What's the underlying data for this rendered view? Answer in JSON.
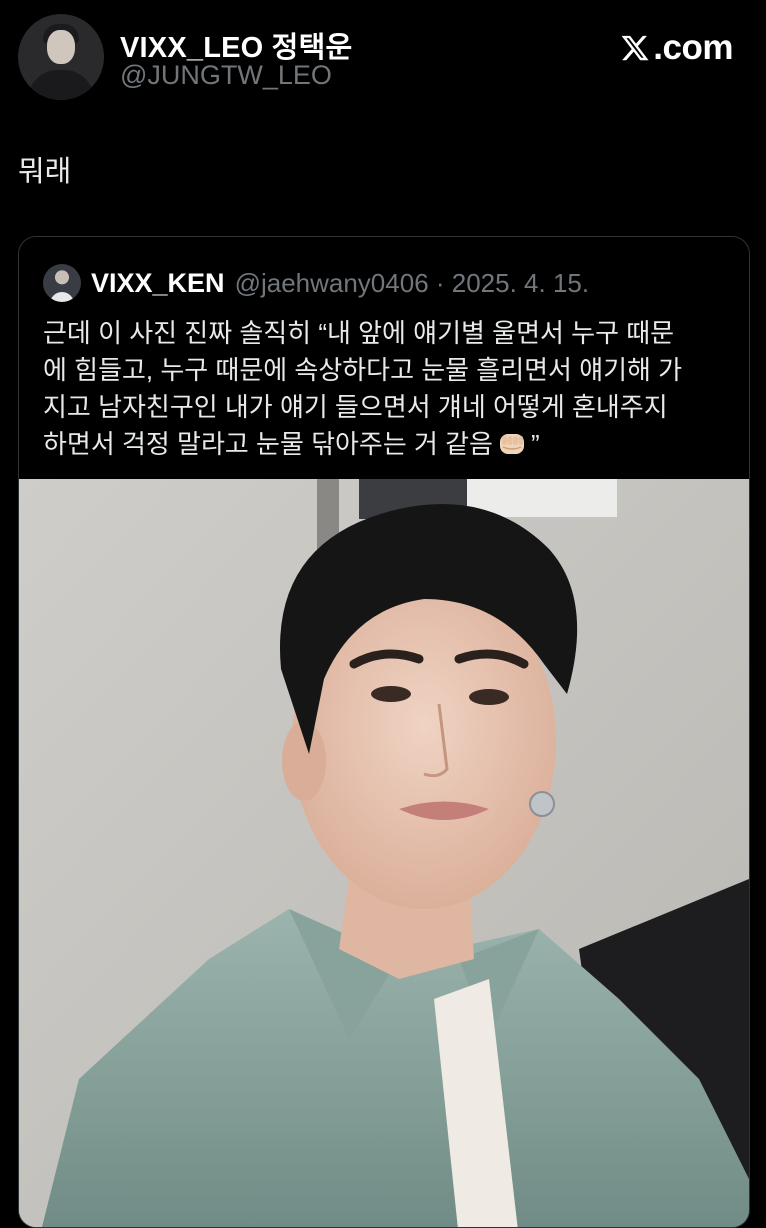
{
  "author": {
    "display_name": "VIXX_LEO 정택운",
    "handle": "@JUNGTW_LEO",
    "avatar_icon": "profile-photo"
  },
  "brand": {
    "logo_icon": "x-logo-icon",
    "logo_suffix": ".com"
  },
  "tweet": {
    "text": "뭐래"
  },
  "quote": {
    "author_name": "VIXX_KEN",
    "meta": "@jaehwany0406 · 2025. 4. 15.",
    "lines": [
      "근데 이 사진 진짜 솔직히 “내 앞에 얘기별 울면서 누구 때문",
      "에 힘들고, 누구 때문에 속상하다고 눈물 흘리면서 얘기해 가",
      "지고 남자친구인 내가 얘기 들으면서 걔네 어떻게 혼내주지"
    ],
    "last_line_prefix": "하면서 걱정 말라고 눈물 닦아주는 거 같음",
    "last_line_suffix": "”",
    "emoji_icon": "fist-emoji-icon",
    "photo_icon": "selfie-photo"
  },
  "colors": {
    "background": "#000000",
    "text": "#e7e9ea",
    "muted": "#71767b",
    "border": "#2f3336"
  }
}
